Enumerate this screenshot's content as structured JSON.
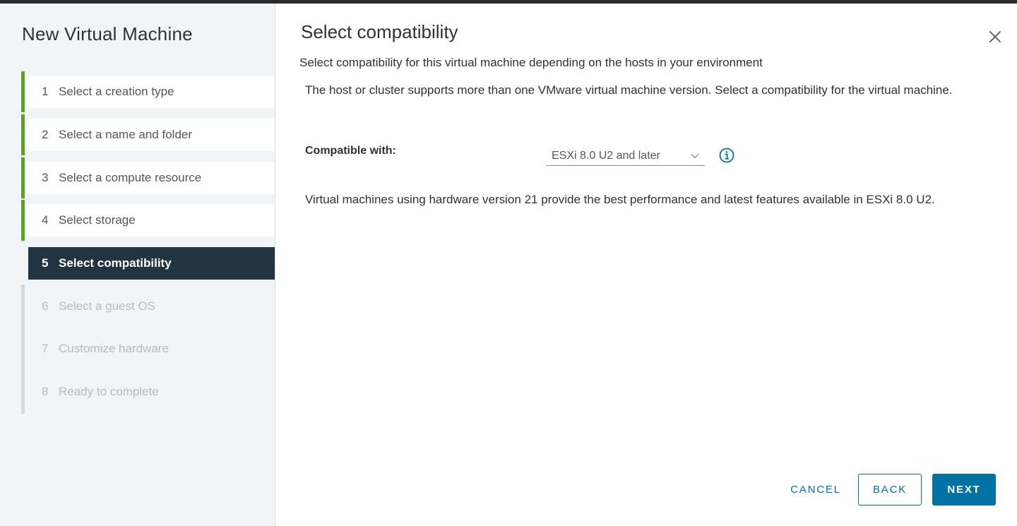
{
  "wizard": {
    "title": "New Virtual Machine",
    "steps": [
      {
        "num": "1",
        "label": "Select a creation type",
        "state": "done"
      },
      {
        "num": "2",
        "label": "Select a name and folder",
        "state": "done"
      },
      {
        "num": "3",
        "label": "Select a compute resource",
        "state": "done"
      },
      {
        "num": "4",
        "label": "Select storage",
        "state": "done"
      },
      {
        "num": "5",
        "label": "Select compatibility",
        "state": "current"
      },
      {
        "num": "6",
        "label": "Select a guest OS",
        "state": "todo"
      },
      {
        "num": "7",
        "label": "Customize hardware",
        "state": "todo"
      },
      {
        "num": "8",
        "label": "Ready to complete",
        "state": "todo"
      }
    ]
  },
  "page": {
    "title": "Select compatibility",
    "subtitle": "Select compatibility for this virtual machine depending on the hosts in your environment",
    "description": "The host or cluster supports more than one VMware virtual machine version. Select a compatibility for the virtual machine.",
    "compat_label": "Compatible with:",
    "compat_value": "ESXi 8.0 U2 and later",
    "performance_note": "Virtual machines using hardware version 21 provide the best performance and latest features available in ESXi 8.0 U2."
  },
  "footer": {
    "cancel": "CANCEL",
    "back": "BACK",
    "next": "NEXT"
  },
  "icons": {
    "close": "close-icon",
    "chevron": "chevron-down-icon",
    "info": "info-icon"
  },
  "colors": {
    "accent": "#0072a3",
    "done_bar": "#5aa220",
    "current_bg": "#22343f"
  }
}
